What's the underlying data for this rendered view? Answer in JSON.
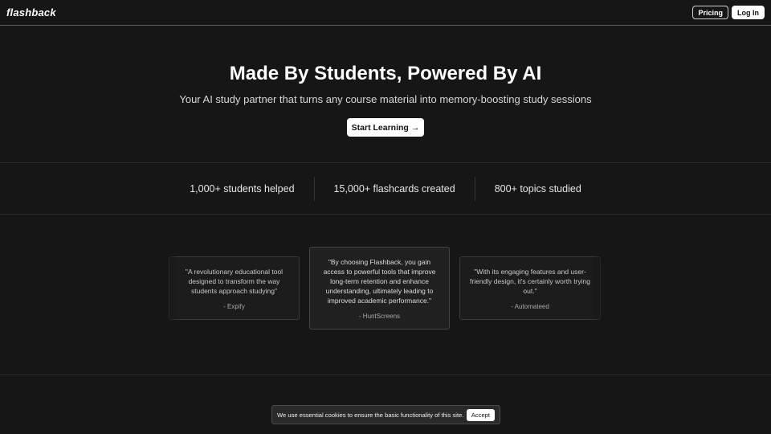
{
  "header": {
    "logo": "flashback",
    "pricing_label": "Pricing",
    "login_label": "Log In"
  },
  "hero": {
    "title": "Made By Students, Powered By AI",
    "subtitle": "Your AI study partner that turns any course material into memory-boosting study sessions",
    "cta_label": "Start Learning",
    "cta_icon": "→"
  },
  "stats": [
    "1,000+ students helped",
    "15,000+ flashcards created",
    "800+ topics studied"
  ],
  "testimonials": [
    {
      "quote": "\"A revolutionary educational tool designed to transform the way students approach studying\"",
      "source": "- Expify"
    },
    {
      "quote": "\"By choosing Flashback, you gain access to powerful tools that improve long-term retention and enhance understanding, ultimately leading to improved academic performance.\"",
      "source": "- HuntScreens"
    },
    {
      "quote": "\"With its engaging features and user-friendly design, it's certainly worth trying out.\"",
      "source": "- Automateed"
    }
  ],
  "cookie": {
    "message": "We use essential cookies to ensure the basic functionality of this site.",
    "accept_label": "Accept"
  }
}
